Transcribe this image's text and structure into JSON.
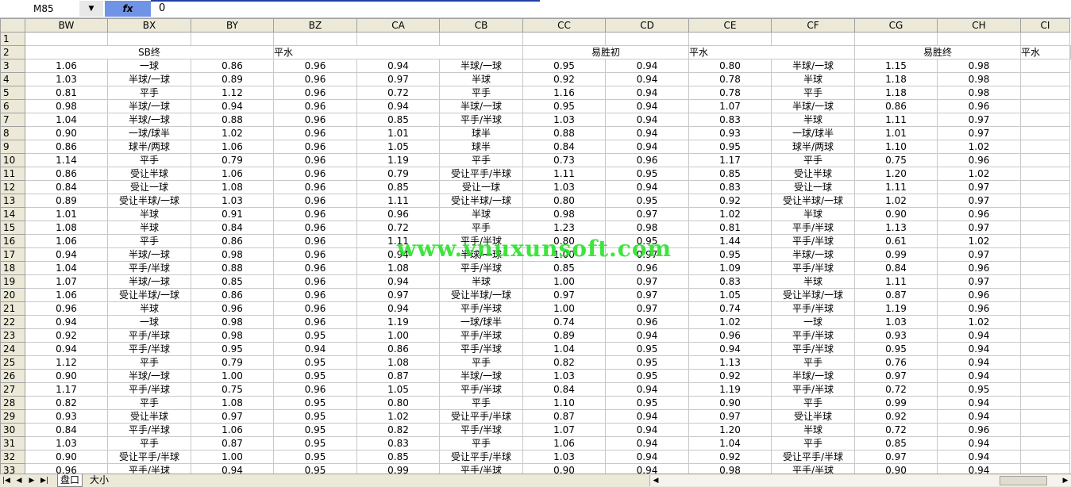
{
  "formula_bar": {
    "cell_ref": "M85",
    "fx": "fx",
    "value": "0"
  },
  "columns": [
    "BW",
    "BX",
    "BY",
    "BZ",
    "CA",
    "CB",
    "CC",
    "CD",
    "CE",
    "CF",
    "CG",
    "CH",
    "CI"
  ],
  "header_row2": {
    "bx": "SB终",
    "bz": "平水",
    "cb": "易胜初",
    "cd": "平水",
    "cf": "易胜终",
    "ch": "平水"
  },
  "rows": [
    [
      "1",
      "",
      "",
      "",
      "",
      "",
      "",
      "",
      "",
      "",
      "",
      "",
      "",
      ""
    ],
    [
      "3",
      "1.06",
      "一球",
      "0.86",
      "0.96",
      "0.94",
      "半球/一球",
      "0.95",
      "0.94",
      "0.80",
      "半球/一球",
      "1.15",
      "0.98",
      ""
    ],
    [
      "4",
      "1.03",
      "半球/一球",
      "0.89",
      "0.96",
      "0.97",
      "半球",
      "0.92",
      "0.94",
      "0.78",
      "半球",
      "1.18",
      "0.98",
      ""
    ],
    [
      "5",
      "0.81",
      "平手",
      "1.12",
      "0.96",
      "0.72",
      "平手",
      "1.16",
      "0.94",
      "0.78",
      "平手",
      "1.18",
      "0.98",
      ""
    ],
    [
      "6",
      "0.98",
      "半球/一球",
      "0.94",
      "0.96",
      "0.94",
      "半球/一球",
      "0.95",
      "0.94",
      "1.07",
      "半球/一球",
      "0.86",
      "0.96",
      ""
    ],
    [
      "7",
      "1.04",
      "半球/一球",
      "0.88",
      "0.96",
      "0.85",
      "平手/半球",
      "1.03",
      "0.94",
      "0.83",
      "半球",
      "1.11",
      "0.97",
      ""
    ],
    [
      "8",
      "0.90",
      "一球/球半",
      "1.02",
      "0.96",
      "1.01",
      "球半",
      "0.88",
      "0.94",
      "0.93",
      "一球/球半",
      "1.01",
      "0.97",
      ""
    ],
    [
      "9",
      "0.86",
      "球半/两球",
      "1.06",
      "0.96",
      "1.05",
      "球半",
      "0.84",
      "0.94",
      "0.95",
      "球半/两球",
      "1.10",
      "1.02",
      ""
    ],
    [
      "10",
      "1.14",
      "平手",
      "0.79",
      "0.96",
      "1.19",
      "平手",
      "0.73",
      "0.96",
      "1.17",
      "平手",
      "0.75",
      "0.96",
      ""
    ],
    [
      "11",
      "0.86",
      "受让半球",
      "1.06",
      "0.96",
      "0.79",
      "受让平手/半球",
      "1.11",
      "0.95",
      "0.85",
      "受让半球",
      "1.20",
      "1.02",
      ""
    ],
    [
      "12",
      "0.84",
      "受让一球",
      "1.08",
      "0.96",
      "0.85",
      "受让一球",
      "1.03",
      "0.94",
      "0.83",
      "受让一球",
      "1.11",
      "0.97",
      ""
    ],
    [
      "13",
      "0.89",
      "受让半球/一球",
      "1.03",
      "0.96",
      "1.11",
      "受让半球/一球",
      "0.80",
      "0.95",
      "0.92",
      "受让半球/一球",
      "1.02",
      "0.97",
      ""
    ],
    [
      "14",
      "1.01",
      "半球",
      "0.91",
      "0.96",
      "0.96",
      "半球",
      "0.98",
      "0.97",
      "1.02",
      "半球",
      "0.90",
      "0.96",
      ""
    ],
    [
      "15",
      "1.08",
      "半球",
      "0.84",
      "0.96",
      "0.72",
      "平手",
      "1.23",
      "0.98",
      "0.81",
      "平手/半球",
      "1.13",
      "0.97",
      ""
    ],
    [
      "16",
      "1.06",
      "平手",
      "0.86",
      "0.96",
      "1.11",
      "平手/半球",
      "0.80",
      "0.95",
      "1.44",
      "平手/半球",
      "0.61",
      "1.02",
      ""
    ],
    [
      "17",
      "0.94",
      "半球/一球",
      "0.98",
      "0.96",
      "0.94",
      "半球/一球",
      "1.00",
      "0.97",
      "0.95",
      "半球/一球",
      "0.99",
      "0.97",
      ""
    ],
    [
      "18",
      "1.04",
      "平手/半球",
      "0.88",
      "0.96",
      "1.08",
      "平手/半球",
      "0.85",
      "0.96",
      "1.09",
      "平手/半球",
      "0.84",
      "0.96",
      ""
    ],
    [
      "19",
      "1.07",
      "半球/一球",
      "0.85",
      "0.96",
      "0.94",
      "半球",
      "1.00",
      "0.97",
      "0.83",
      "半球",
      "1.11",
      "0.97",
      ""
    ],
    [
      "20",
      "1.06",
      "受让半球/一球",
      "0.86",
      "0.96",
      "0.97",
      "受让半球/一球",
      "0.97",
      "0.97",
      "1.05",
      "受让半球/一球",
      "0.87",
      "0.96",
      ""
    ],
    [
      "21",
      "0.96",
      "半球",
      "0.96",
      "0.96",
      "0.94",
      "平手/半球",
      "1.00",
      "0.97",
      "0.74",
      "平手/半球",
      "1.19",
      "0.96",
      ""
    ],
    [
      "22",
      "0.94",
      "一球",
      "0.98",
      "0.96",
      "1.19",
      "一球/球半",
      "0.74",
      "0.96",
      "1.02",
      "一球",
      "1.03",
      "1.02",
      ""
    ],
    [
      "23",
      "0.92",
      "平手/半球",
      "0.98",
      "0.95",
      "1.00",
      "平手/半球",
      "0.89",
      "0.94",
      "0.96",
      "平手/半球",
      "0.93",
      "0.94",
      ""
    ],
    [
      "24",
      "0.94",
      "平手/半球",
      "0.95",
      "0.94",
      "0.86",
      "平手/半球",
      "1.04",
      "0.95",
      "0.94",
      "平手/半球",
      "0.95",
      "0.94",
      ""
    ],
    [
      "25",
      "1.12",
      "平手",
      "0.79",
      "0.95",
      "1.08",
      "平手",
      "0.82",
      "0.95",
      "1.13",
      "平手",
      "0.76",
      "0.94",
      ""
    ],
    [
      "26",
      "0.90",
      "半球/一球",
      "1.00",
      "0.95",
      "0.87",
      "半球/一球",
      "1.03",
      "0.95",
      "0.92",
      "半球/一球",
      "0.97",
      "0.94",
      ""
    ],
    [
      "27",
      "1.17",
      "平手/半球",
      "0.75",
      "0.96",
      "1.05",
      "平手/半球",
      "0.84",
      "0.94",
      "1.19",
      "平手/半球",
      "0.72",
      "0.95",
      ""
    ],
    [
      "28",
      "0.82",
      "平手",
      "1.08",
      "0.95",
      "0.80",
      "平手",
      "1.10",
      "0.95",
      "0.90",
      "平手",
      "0.99",
      "0.94",
      ""
    ],
    [
      "29",
      "0.93",
      "受让半球",
      "0.97",
      "0.95",
      "1.02",
      "受让平手/半球",
      "0.87",
      "0.94",
      "0.97",
      "受让半球",
      "0.92",
      "0.94",
      ""
    ],
    [
      "30",
      "0.84",
      "平手/半球",
      "1.06",
      "0.95",
      "0.82",
      "平手/半球",
      "1.07",
      "0.94",
      "1.20",
      "半球",
      "0.72",
      "0.96",
      ""
    ],
    [
      "31",
      "1.03",
      "平手",
      "0.87",
      "0.95",
      "0.83",
      "平手",
      "1.06",
      "0.94",
      "1.04",
      "平手",
      "0.85",
      "0.94",
      ""
    ],
    [
      "32",
      "0.90",
      "受让平手/半球",
      "1.00",
      "0.95",
      "0.85",
      "受让平手/半球",
      "1.03",
      "0.94",
      "0.92",
      "受让平手/半球",
      "0.97",
      "0.94",
      ""
    ],
    [
      "33",
      "0.96",
      "平手/半球",
      "0.94",
      "0.95",
      "0.99",
      "平手/半球",
      "0.90",
      "0.94",
      "0.98",
      "平手/半球",
      "0.90",
      "0.94",
      ""
    ]
  ],
  "watermark": "www.vnuxunsoft.com",
  "sheet_tabs": [
    {
      "label": "盘口",
      "active": true
    },
    {
      "label": "大小",
      "active": false
    }
  ]
}
